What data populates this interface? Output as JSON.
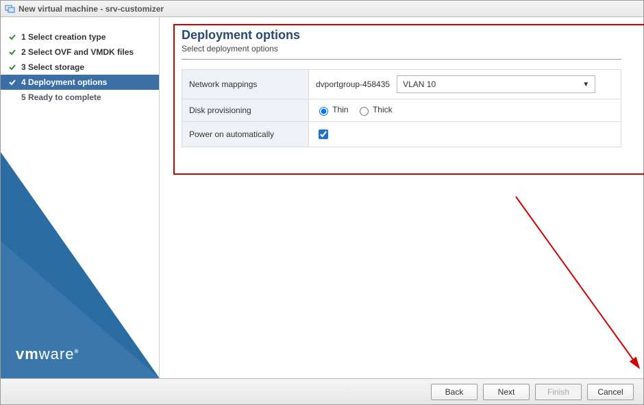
{
  "window": {
    "title": "New virtual machine - srv-customizer"
  },
  "wizard": {
    "steps": [
      {
        "label": "1 Select creation type",
        "state": "done"
      },
      {
        "label": "2 Select OVF and VMDK files",
        "state": "done"
      },
      {
        "label": "3 Select storage",
        "state": "done"
      },
      {
        "label": "4 Deployment options",
        "state": "active"
      },
      {
        "label": "5 Ready to complete",
        "state": "pending"
      }
    ]
  },
  "panel": {
    "heading": "Deployment options",
    "subtitle": "Select deployment options",
    "rows": {
      "network_mappings": {
        "label": "Network mappings",
        "portgroup": "dvportgroup-458435",
        "selected_network": "VLAN 10"
      },
      "disk_provisioning": {
        "label": "Disk provisioning",
        "option_thin": "Thin",
        "option_thick": "Thick",
        "selected": "thin"
      },
      "power_on": {
        "label": "Power on automatically",
        "checked": true
      }
    }
  },
  "footer": {
    "back": "Back",
    "next": "Next",
    "finish": "Finish",
    "cancel": "Cancel"
  },
  "branding": {
    "logo_text_left": "vm",
    "logo_text_right": "ware",
    "reg": "®"
  }
}
